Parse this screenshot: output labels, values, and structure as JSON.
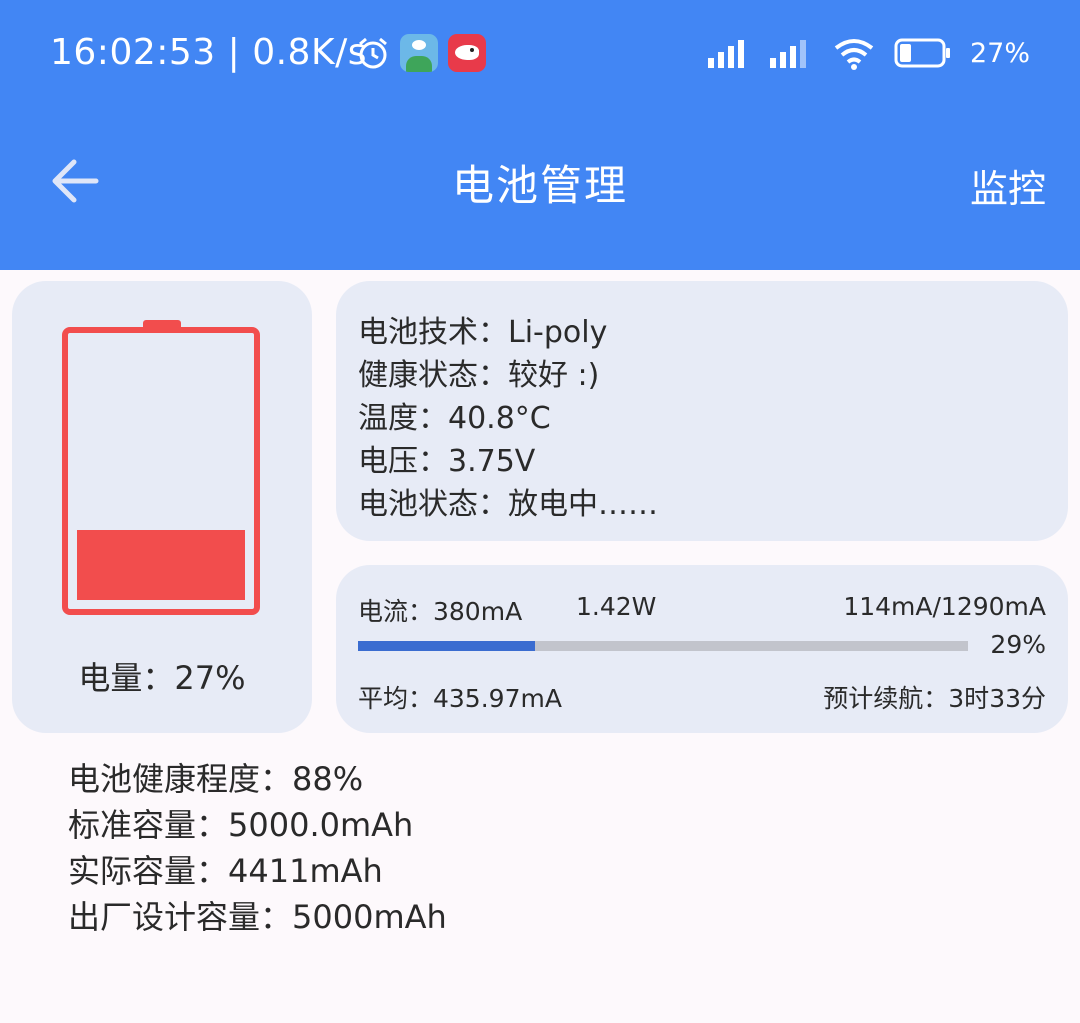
{
  "status_bar": {
    "time": "16:02:53",
    "net_speed": "0.8K/s",
    "battery_percent": "27%",
    "icons": [
      "alarm-clock-icon",
      "app-icon-green",
      "app-icon-red-fish",
      "cellular-signal-icon",
      "cellular-signal-icon",
      "wifi-icon",
      "battery-icon"
    ]
  },
  "header": {
    "title": "电池管理",
    "action_label": "监控",
    "back_icon": "arrow-left-icon"
  },
  "battery_card": {
    "level": 0.27,
    "label": "电量：27%",
    "color": "#f24d4d"
  },
  "info_card": {
    "technology": "电池技术：Li-poly",
    "health": "健康状态：较好 :)",
    "temperature": "温度：40.8°C",
    "voltage": "电压：3.75V",
    "status": "电池状态：放电中……"
  },
  "current_card": {
    "current": "电流：380mA",
    "power": "1.42W",
    "range": "114mA/1290mA",
    "percent_label": "29%",
    "progress": 0.29,
    "average": "平均：435.97mA",
    "estimate": "预计续航：3时33分"
  },
  "details": {
    "health_degree": "电池健康程度：88%",
    "standard_capacity": "标准容量：5000.0mAh",
    "actual_capacity": "实际容量：4411mAh",
    "design_capacity": "出厂设计容量：5000mAh"
  },
  "colors": {
    "primary": "#4286f4",
    "card": "#e7ebf6",
    "battery": "#f24d4d",
    "progress": "#3a6cd0"
  }
}
